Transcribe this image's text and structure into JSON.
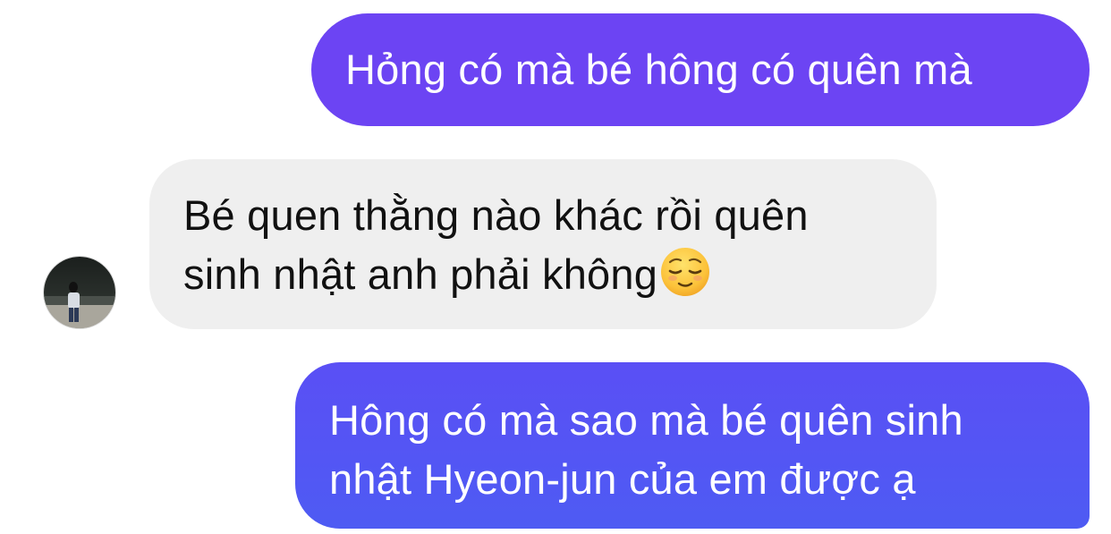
{
  "conversation": {
    "messages": [
      {
        "sender": "me",
        "lines": [
          "Hỏng có mà bé hông có quên mà"
        ]
      },
      {
        "sender": "other",
        "lines": [
          "Bé quen thằng nào khác rồi quên",
          "sinh nhật anh phải không"
        ],
        "emoji": "relieved-face-emoji"
      },
      {
        "sender": "me",
        "lines": [
          "Hông có mà sao mà bé quên sinh",
          "nhật Hyeon-jun của em được ạ"
        ]
      }
    ]
  },
  "colors": {
    "outgoing_bubble": "#6c44f3",
    "outgoing_bubble_2": "#5457f4",
    "incoming_bubble": "#efefef",
    "incoming_text": "#111111",
    "outgoing_text": "#ffffff"
  }
}
